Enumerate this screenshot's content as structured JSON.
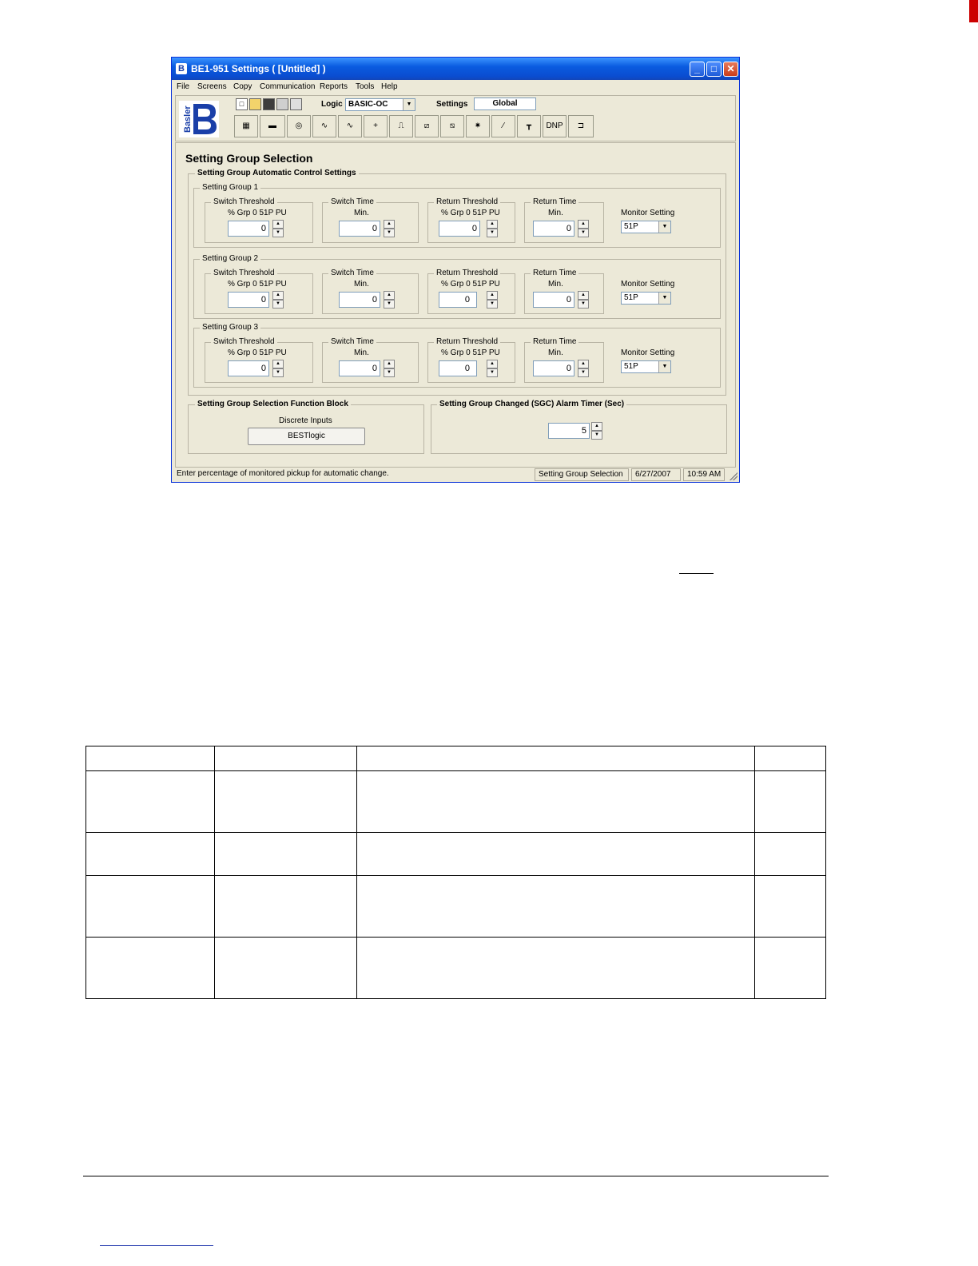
{
  "window": {
    "title": "BE1-951 Settings    ( [Untitled] )",
    "buttons": {
      "minimize": "_",
      "maximize": "□",
      "close": "✕"
    }
  },
  "menu": [
    {
      "label": "File"
    },
    {
      "label": "Screens"
    },
    {
      "label": "Copy"
    },
    {
      "label": "Communication"
    },
    {
      "label": "Reports"
    },
    {
      "label": "Tools"
    },
    {
      "label": "Help"
    }
  ],
  "toolbar": {
    "logo_text": "Basler",
    "logic_label": "Logic",
    "logic_value": "BASIC-OC",
    "settings_label": "Settings",
    "settings_value": "Global",
    "dnp_label": "DNP"
  },
  "screen": {
    "title": "Setting Group Selection",
    "auto_group_title": "Setting Group Automatic Control Settings",
    "groups": [
      {
        "title": "Setting Group 1",
        "switch_threshold": {
          "title": "Switch Threshold",
          "sub": "% Grp 0 51P PU",
          "value": "0"
        },
        "switch_time": {
          "title": "Switch Time",
          "sub": "Min.",
          "value": "0"
        },
        "return_threshold": {
          "title": "Return Threshold",
          "sub": "% Grp 0 51P PU",
          "value": "0"
        },
        "return_time": {
          "title": "Return Time",
          "sub": "Min.",
          "value": "0"
        },
        "monitor_label": "Monitor Setting",
        "monitor_value": "51P"
      },
      {
        "title": "Setting Group 2",
        "switch_threshold": {
          "title": "Switch Threshold",
          "sub": "% Grp 0 51P PU",
          "value": "0"
        },
        "switch_time": {
          "title": "Switch Time",
          "sub": "Min.",
          "value": "0"
        },
        "return_threshold": {
          "title": "Return Threshold",
          "sub": "% Grp 0 51P PU",
          "value": "0"
        },
        "return_time": {
          "title": "Return Time",
          "sub": "Min.",
          "value": "0"
        },
        "monitor_label": "Monitor Setting",
        "monitor_value": "51P"
      },
      {
        "title": "Setting Group 3",
        "switch_threshold": {
          "title": "Switch Threshold",
          "sub": "% Grp 0 51P PU",
          "value": "0"
        },
        "switch_time": {
          "title": "Switch Time",
          "sub": "Min.",
          "value": "0"
        },
        "return_threshold": {
          "title": "Return Threshold",
          "sub": "% Grp 0 51P PU",
          "value": "0"
        },
        "return_time": {
          "title": "Return Time",
          "sub": "Min.",
          "value": "0"
        },
        "monitor_label": "Monitor Setting",
        "monitor_value": "51P"
      }
    ],
    "function_block": {
      "title": "Setting Group Selection Function Block",
      "discrete_label": "Discrete Inputs",
      "button_label": "BESTlogic"
    },
    "alarm_timer": {
      "title": "Setting Group Changed (SGC) Alarm Timer (Sec)",
      "value": "5"
    }
  },
  "status": {
    "hint": "Enter percentage of monitored pickup for automatic change.",
    "screen_name": "Setting Group Selection",
    "date": "6/27/2007",
    "time": "10:59 AM"
  }
}
